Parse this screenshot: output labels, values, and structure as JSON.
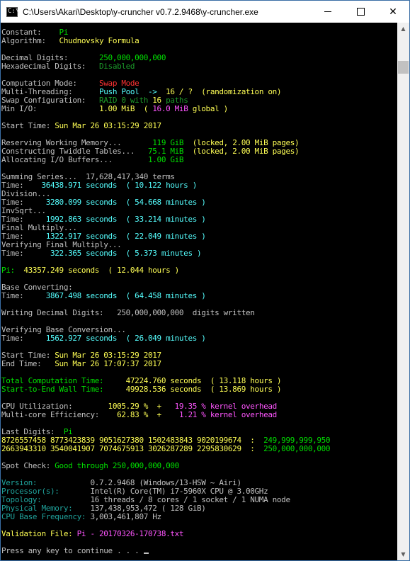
{
  "window": {
    "title": "C:\\Users\\Akari\\Desktop\\y-cruncher v0.7.2.9468\\y-cruncher.exe",
    "icon_text": "C:\\",
    "controls": [
      "minimize-icon",
      "maximize-icon",
      "close-icon"
    ],
    "close_glyph": "✕"
  },
  "scrollbar": {
    "up_glyph": "▲",
    "down_glyph": "▼",
    "position": 0.03
  },
  "console": {
    "lines": [
      [
        [
          "w",
          "Constant:    "
        ],
        [
          "g",
          "Pi"
        ]
      ],
      [
        [
          "w",
          "Algorithm:   "
        ],
        [
          "y",
          "Chudnovsky Formula"
        ]
      ],
      [],
      [
        [
          "w",
          "Decimal Digits:       "
        ],
        [
          "g",
          "250,000,000,000"
        ]
      ],
      [
        [
          "w",
          "Hexadecimal Digits:   "
        ],
        [
          "dg",
          "Disabled"
        ]
      ],
      [],
      [
        [
          "w",
          "Computation Mode:     "
        ],
        [
          "r",
          "Swap Mode"
        ]
      ],
      [
        [
          "w",
          "Multi-Threading:      "
        ],
        [
          "c",
          "Push Pool  ->  "
        ],
        [
          "y",
          "16 / ?  (randomization on)"
        ]
      ],
      [
        [
          "w",
          "Swap Configuration:   "
        ],
        [
          "dg",
          "RAID 0 with "
        ],
        [
          "y",
          "16"
        ],
        [
          "dg",
          " paths"
        ]
      ],
      [
        [
          "w",
          "Min I/O:              "
        ],
        [
          "y",
          "1.00 MiB  ( "
        ],
        [
          "m",
          "16.0 MiB"
        ],
        [
          "y",
          " global )"
        ]
      ],
      [],
      [
        [
          "w",
          "Start Time: "
        ],
        [
          "y",
          "Sun Mar 26 03:15:29 2017"
        ]
      ],
      [],
      [
        [
          "w",
          "Reserving Working Memory...       "
        ],
        [
          "g",
          "119 GiB"
        ],
        [
          "y",
          "  (locked, 2.00 MiB pages)"
        ]
      ],
      [
        [
          "w",
          "Constructing Twiddle Tables...   "
        ],
        [
          "g",
          "75.1 MiB"
        ],
        [
          "y",
          "  (locked, 2.00 MiB pages)"
        ]
      ],
      [
        [
          "w",
          "Allocating I/O Buffers...        "
        ],
        [
          "g",
          "1.00 GiB"
        ]
      ],
      [],
      [
        [
          "w",
          "Summing Series...  17,628,417,340 terms"
        ]
      ],
      [
        [
          "w",
          "Time:    "
        ],
        [
          "c",
          "36438.971 seconds  ( 10.122 hours )"
        ]
      ],
      [
        [
          "w",
          "Division..."
        ]
      ],
      [
        [
          "w",
          "Time:     "
        ],
        [
          "c",
          "3280.099 seconds  ( 54.668 minutes )"
        ]
      ],
      [
        [
          "w",
          "InvSqrt..."
        ]
      ],
      [
        [
          "w",
          "Time:     "
        ],
        [
          "c",
          "1992.863 seconds  ( 33.214 minutes )"
        ]
      ],
      [
        [
          "w",
          "Final Multiply..."
        ]
      ],
      [
        [
          "w",
          "Time:     "
        ],
        [
          "c",
          "1322.917 seconds  ( 22.049 minutes )"
        ]
      ],
      [
        [
          "w",
          "Verifying Final Multiply..."
        ]
      ],
      [
        [
          "w",
          "Time:      "
        ],
        [
          "c",
          "322.365 seconds  ( 5.373 minutes )"
        ]
      ],
      [],
      [
        [
          "g",
          "Pi:  "
        ],
        [
          "y",
          "43357.249 seconds  ( 12.044 hours )"
        ]
      ],
      [],
      [
        [
          "w",
          "Base Converting:"
        ]
      ],
      [
        [
          "w",
          "Time:     "
        ],
        [
          "c",
          "3867.498 seconds  ( 64.458 minutes )"
        ]
      ],
      [],
      [
        [
          "w",
          "Writing Decimal Digits:   250,000,000,000  digits written"
        ]
      ],
      [],
      [
        [
          "w",
          "Verifying Base Conversion..."
        ]
      ],
      [
        [
          "w",
          "Time:     "
        ],
        [
          "c",
          "1562.927 seconds  ( 26.049 minutes )"
        ]
      ],
      [],
      [
        [
          "w",
          "Start Time: "
        ],
        [
          "y",
          "Sun Mar 26 03:15:29 2017"
        ]
      ],
      [
        [
          "w",
          "End Time:   "
        ],
        [
          "y",
          "Sun Mar 26 17:07:37 2017"
        ]
      ],
      [],
      [
        [
          "g",
          "Total Computation Time:     "
        ],
        [
          "y",
          "47224.760 seconds  ( 13.118 hours )"
        ]
      ],
      [
        [
          "g",
          "Start-to-End Wall Time:     "
        ],
        [
          "y",
          "49928.536 seconds  ( 13.869 hours )"
        ]
      ],
      [],
      [
        [
          "w",
          "CPU Utilization:        "
        ],
        [
          "y",
          "1005.29 %  +   "
        ],
        [
          "m",
          "19.35 % kernel overhead"
        ]
      ],
      [
        [
          "w",
          "Multi-core Efficiency:    "
        ],
        [
          "y",
          "62.83 %  +    "
        ],
        [
          "m",
          "1.21 % kernel overhead"
        ]
      ],
      [],
      [
        [
          "w",
          "Last Digits:  "
        ],
        [
          "g",
          "Pi"
        ]
      ],
      [
        [
          "y",
          "8726557458 8773423839 9051627380 1502483843 9020199674  :  "
        ],
        [
          "g",
          "249,999,999,950"
        ]
      ],
      [
        [
          "y",
          "2663943310 3540041907 7074675913 3026287289 2295830629  :  "
        ],
        [
          "g",
          "250,000,000,000"
        ]
      ],
      [],
      [
        [
          "w",
          "Spot Check: "
        ],
        [
          "g",
          "Good through 250,000,000,000"
        ]
      ],
      [],
      [
        [
          "t",
          "Version:            "
        ],
        [
          "w",
          "0.7.2.9468 (Windows/13-HSW ~ Airi)"
        ]
      ],
      [
        [
          "t",
          "Processor(s):       "
        ],
        [
          "w",
          "Intel(R) Core(TM) i7-5960X CPU @ 3.00GHz"
        ]
      ],
      [
        [
          "t",
          "Topology:           "
        ],
        [
          "w",
          "16 threads / 8 cores / 1 socket / 1 NUMA node"
        ]
      ],
      [
        [
          "t",
          "Physical Memory:    "
        ],
        [
          "w",
          "137,438,953,472 ( 128 GiB)"
        ]
      ],
      [
        [
          "t",
          "CPU Base Frequency: "
        ],
        [
          "w",
          "3,003,461,807 Hz"
        ]
      ],
      [],
      [
        [
          "y",
          "Validation File: "
        ],
        [
          "m",
          "Pi - 20170326-170738.txt"
        ]
      ],
      [],
      [
        [
          "w",
          "Press any key to continue . . . "
        ]
      ]
    ]
  }
}
